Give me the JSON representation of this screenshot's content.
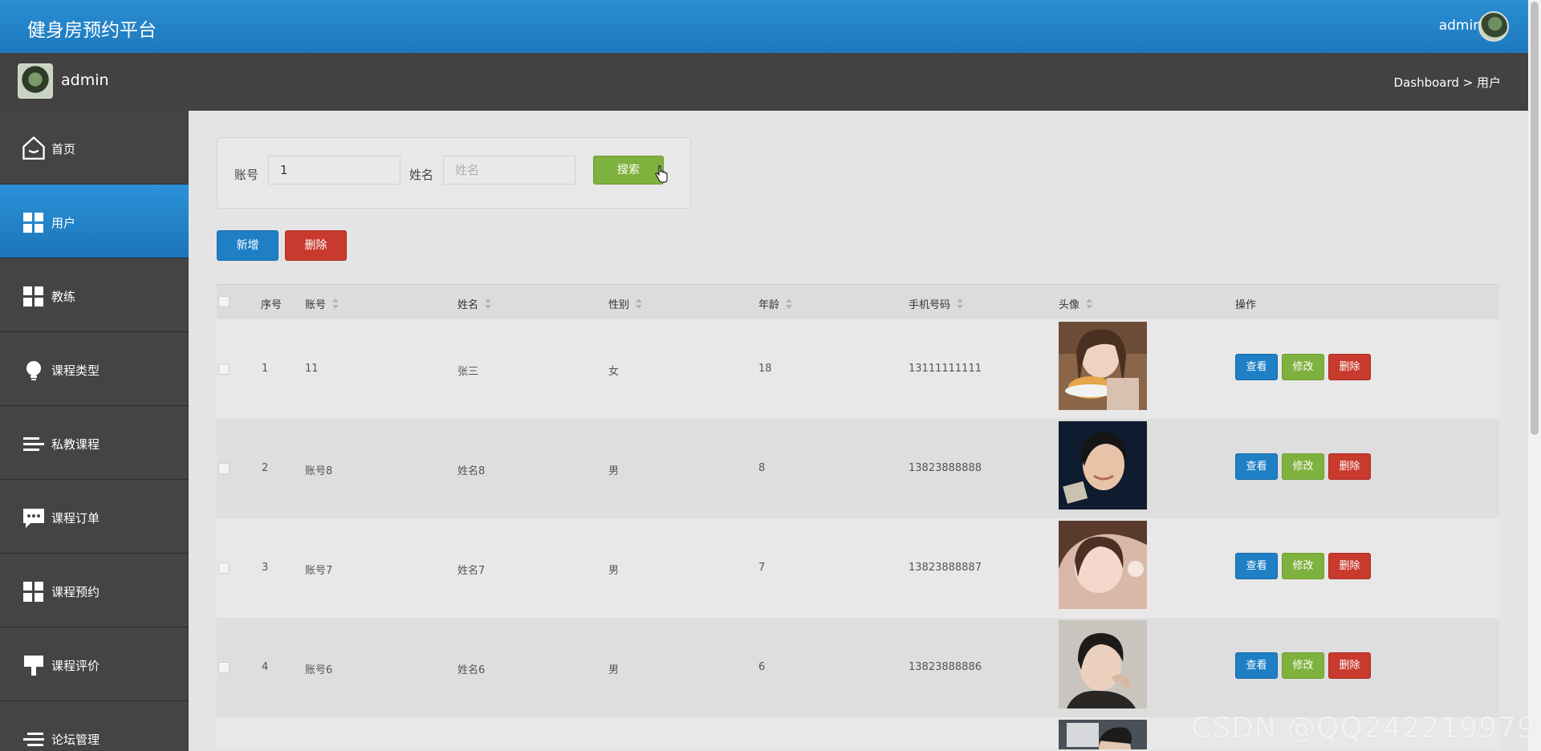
{
  "app": {
    "title": "健身房预约平台",
    "user": "admin"
  },
  "subbar": {
    "name": "admin",
    "breadcrumb": "Dashboard > 用户"
  },
  "sidebar": {
    "items": [
      {
        "label": "首页",
        "icon": "home-icon",
        "active": false
      },
      {
        "label": "用户",
        "icon": "grid-icon",
        "active": true
      },
      {
        "label": "教练",
        "icon": "grid-icon",
        "active": false
      },
      {
        "label": "课程类型",
        "icon": "bulb-icon",
        "active": false
      },
      {
        "label": "私教课程",
        "icon": "list-icon",
        "active": false
      },
      {
        "label": "课程订单",
        "icon": "chat-icon",
        "active": false
      },
      {
        "label": "课程预约",
        "icon": "grid-icon",
        "active": false
      },
      {
        "label": "课程评价",
        "icon": "brush-icon",
        "active": false
      },
      {
        "label": "论坛管理",
        "icon": "list-icon",
        "active": false
      }
    ]
  },
  "search": {
    "account_label": "账号",
    "account_value": "1",
    "name_label": "姓名",
    "name_placeholder": "姓名",
    "button": "搜索"
  },
  "actions": {
    "add": "新增",
    "delete": "删除"
  },
  "table": {
    "headers": [
      "序号",
      "账号",
      "姓名",
      "性别",
      "年龄",
      "手机号码",
      "头像",
      "操作"
    ],
    "row_buttons": {
      "view": "查看",
      "edit": "修改",
      "delete": "删除"
    },
    "rows": [
      {
        "index": "1",
        "account": "11",
        "name": "张三",
        "gender": "女",
        "age": "18",
        "phone": "13111111111"
      },
      {
        "index": "2",
        "account": "账号8",
        "name": "姓名8",
        "gender": "男",
        "age": "8",
        "phone": "13823888888"
      },
      {
        "index": "3",
        "account": "账号7",
        "name": "姓名7",
        "gender": "男",
        "age": "7",
        "phone": "13823888887"
      },
      {
        "index": "4",
        "account": "账号6",
        "name": "姓名6",
        "gender": "男",
        "age": "6",
        "phone": "13823888886"
      }
    ]
  },
  "watermark": "CSDN @QQ242219979",
  "colors": {
    "primary": "#1e7fc5",
    "success": "#7fb13e",
    "danger": "#c8392e",
    "sidebar": "#444444"
  }
}
